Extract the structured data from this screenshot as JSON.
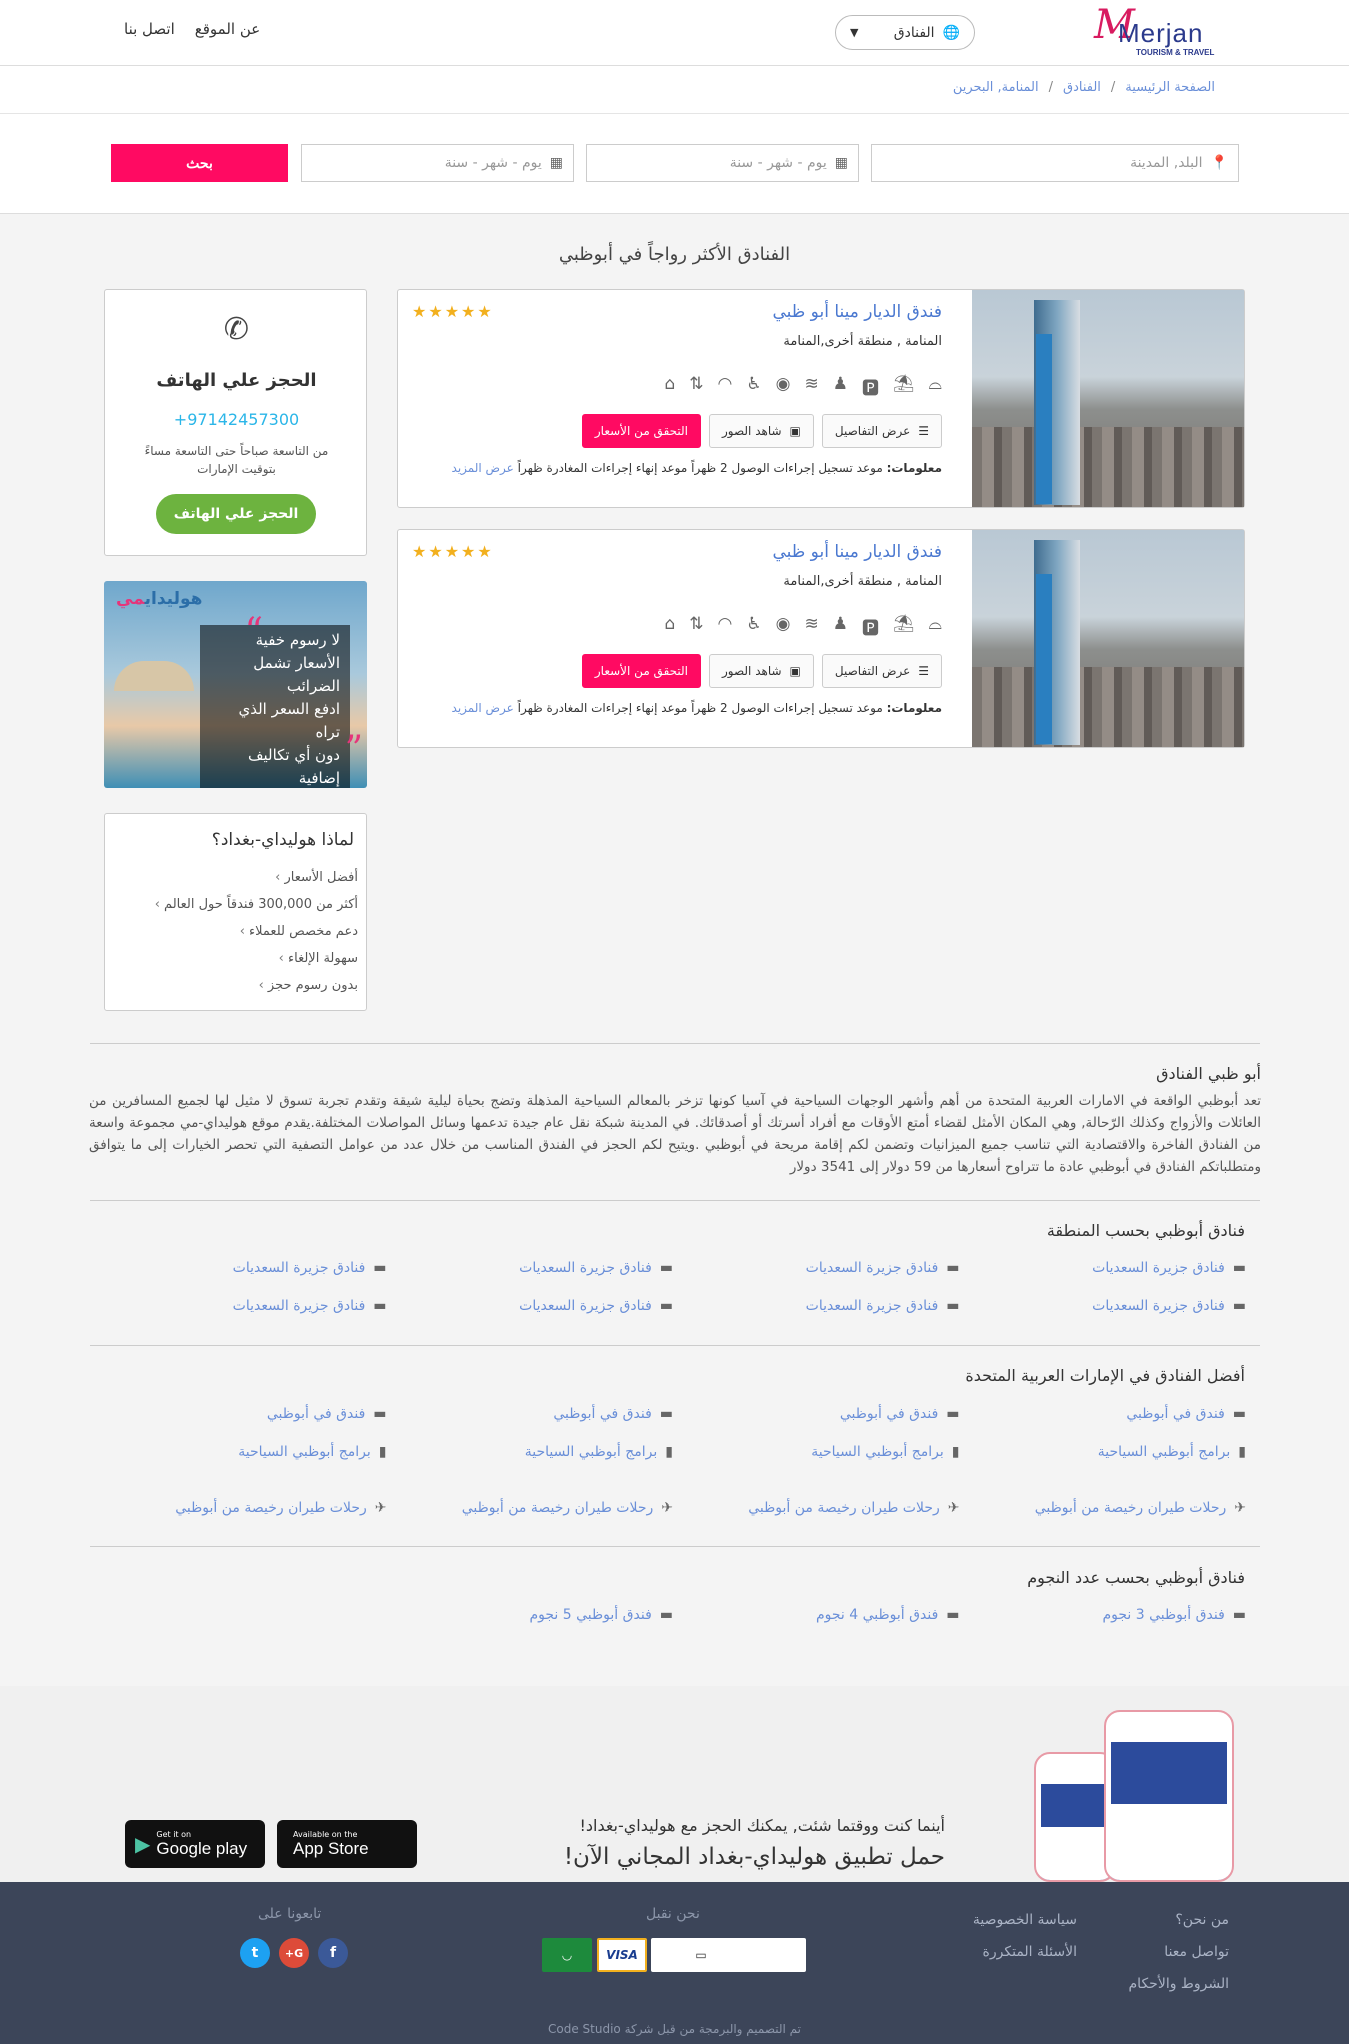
{
  "header": {
    "logo_main": "Merjan",
    "logo_sub": "TOURISM & TRAVEL",
    "hotel_select": "الفنادق",
    "nav": [
      "عن الموقع",
      "اتصل بنا"
    ]
  },
  "breadcrumb": [
    "الصفحة الرئيسية",
    "الفنادق",
    "المنامة, البحرين"
  ],
  "search": {
    "destination_placeholder": "البلد, المدينة",
    "checkin_placeholder": "يوم - شهر - سنة",
    "checkout_placeholder": "يوم - شهر - سنة",
    "button": "بحث"
  },
  "section_title": "الفنادق الأكثر رواجاً في أبوظبي",
  "hotels": [
    {
      "name": "فندق الديار مينا أبو ظبي",
      "stars": "★★★★★",
      "location": "المنامة , منطقة أخرى,المنامة",
      "btn_details": "عرض التفاصيل",
      "btn_photos": "شاهد الصور",
      "btn_prices": "التحقق من الأسعار",
      "info_label": "معلومات:",
      "info_text": "موعد تسجيل إجراءات الوصول 2 ظهراً موعد إنهاء إجراءات المغادرة ظهراً",
      "more": "عرض المزيد"
    },
    {
      "name": "فندق الديار مينا أبو ظبي",
      "stars": "★★★★★",
      "location": "المنامة , منطقة أخرى,المنامة",
      "btn_details": "عرض التفاصيل",
      "btn_photos": "شاهد الصور",
      "btn_prices": "التحقق من الأسعار",
      "info_label": "معلومات:",
      "info_text": "موعد تسجيل إجراءات الوصول 2 ظهراً موعد إنهاء إجراءات المغادرة ظهراً",
      "more": "عرض المزيد"
    }
  ],
  "amenity_icons": [
    "room-service-icon",
    "beach-icon",
    "parking-icon",
    "concierge-icon",
    "pool-icon",
    "restaurant-icon",
    "accessible-icon",
    "wifi-icon",
    "elevator-icon",
    "laundry-icon"
  ],
  "phone_booking": {
    "title": "الحجز علي الهاتف",
    "number": "+97142457300",
    "hours": "من التاسعة صباحاً حتى التاسعة مساءً بتوقيت الإمارات",
    "button": "الحجز علي الهاتف"
  },
  "promo": {
    "brand_a": "هوليداي",
    "brand_b": "مي",
    "points": [
      "لا رسوم خفية",
      "الأسعار تشمل الضرائب",
      "ادفع السعر الذي تراه",
      "دون أي تكاليف إضافية"
    ]
  },
  "why": {
    "title": "لماذا هوليداي-بغداد؟",
    "items": [
      "أفضل الأسعار",
      "أكثر من 300,000 فندقاً حول العالم",
      "دعم مخصص للعملاء",
      "سهولة الإلغاء",
      "بدون رسوم حجز"
    ]
  },
  "about": {
    "title": "أبو ظبي الفنادق",
    "text": "تعد أبوظبي الواقعة في الامارات العربية المتحدة من أهم وأشهر الوجهات السياحية في آسيا كونها تزخر بالمعالم السياحية المذهلة وتضج بحياة ليلية شيقة وتقدم تجربة تسوق لا مثيل لها لجميع المسافرين من العائلات والأزواج وكذلك الرّحالة, وهي المكان الأمثل لقضاء أمتع الأوقات مع أفراد أسرتك أو أصدقائك. في المدينة شبكة نقل عام جيدة تدعمها وسائل المواصلات المختلفة.يقدم موقع هوليداي-مي مجموعة واسعة من الفنادق الفاخرة والاقتصادية التي تناسب جميع الميزانيات وتضمن لكم إقامة مريحة في أبوظبي .ويتيح لكم الحجز في الفندق المناسب من خلال عدد من عوامل التصفية التي تحصر الخيارات إلى ما يتوافق ومتطلباتكم الفنادق في أبوظبي عادة ما تتراوح أسعارها من 59 دولار إلى 3541 دولار"
  },
  "by_area": {
    "title": "فنادق أبوظبي بحسب المنطقة",
    "links": [
      "فنادق جزيرة السعديات",
      "فنادق جزيرة السعديات",
      "فنادق جزيرة السعديات",
      "فنادق جزيرة السعديات",
      "فنادق جزيرة السعديات",
      "فنادق جزيرة السعديات",
      "فنادق جزيرة السعديات",
      "فنادق جزيرة السعديات"
    ]
  },
  "best_uae": {
    "title": "أفضل الفنادق في الإمارات العربية المتحدة",
    "row1": [
      "فندق في أبوظبي",
      "فندق في أبوظبي",
      "فندق في أبوظبي",
      "فندق في أبوظبي"
    ],
    "row2": [
      "برامج أبوظبي السياحية",
      "برامج أبوظبي السياحية",
      "برامج أبوظبي السياحية",
      "برامج أبوظبي السياحية"
    ],
    "row3": [
      "رحلات طيران رخيصة من أبوظبي",
      "رحلات طيران رخيصة من أبوظبي",
      "رحلات طيران رخيصة من أبوظبي",
      "رحلات طيران رخيصة من أبوظبي"
    ]
  },
  "by_stars": {
    "title": "فنادق أبوظبي بحسب عدد النجوم",
    "links": [
      "فندق أبوظبي 3 نجوم",
      "فندق أبوظبي 4 نجوم",
      "فندق أبوظبي 5 نجوم"
    ]
  },
  "app": {
    "line1": "أينما كنت ووقتما شئت, يمكنك الحجز مع هوليداي-بغداد!",
    "line2": "حمل تطبيق هوليداي-بغداد المجاني الآن!",
    "appstore_small": "Available on the",
    "appstore_big": "App Store",
    "gplay_small": "Get it on",
    "gplay_big": "Google play"
  },
  "footer": {
    "col1": [
      "من نحن؟",
      "تواصل معنا",
      "الشروط والأحكام"
    ],
    "col2": [
      "سياسة الخصوصية",
      "الأسئلة المتكررة"
    ],
    "accept_title": "نحن نقبل",
    "payments": [
      "VISA"
    ],
    "follow_title": "تابعونا على",
    "social": [
      "f",
      "G+",
      "t"
    ],
    "credit": "تم التصميم والبرمجة من قبل شركة Code Studio"
  },
  "colors": {
    "accent": "#ff0a62",
    "green": "#6db33f",
    "link": "#6a8fd8",
    "footer": "#3c4559"
  }
}
